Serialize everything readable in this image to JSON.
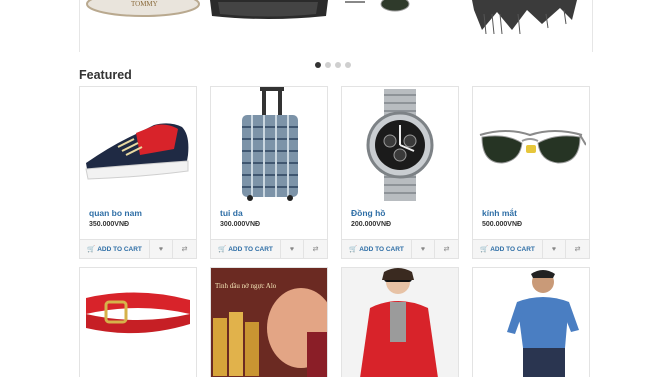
{
  "carousel": {
    "thumbs": [
      {
        "icon": "watch-thumb-icon",
        "text": "TOMMY"
      },
      {
        "icon": "cap-thumb-icon"
      },
      {
        "icon": "sunglasses-thumb-icon"
      },
      {
        "icon": "scarf-thumb-icon"
      }
    ],
    "dots": 4,
    "active_dot": 0
  },
  "featured": {
    "title": "Featured",
    "products": [
      {
        "name": "quan bo nam",
        "price": "350.000VNĐ",
        "icon": "sneaker-icon"
      },
      {
        "name": "tui da",
        "price": "300.000VNĐ",
        "icon": "luggage-icon"
      },
      {
        "name": "Đồng hồ",
        "price": "200.000VNĐ",
        "icon": "watch-icon"
      },
      {
        "name": "kính mắt",
        "price": "500.000VNĐ",
        "icon": "sunglasses-icon"
      }
    ],
    "add_to_cart_label": "ADD TO CART",
    "row2": [
      {
        "icon": "belt-icon"
      },
      {
        "icon": "cosmetics-ad-icon",
        "text": "Tinh dầu nở ngực Alo"
      },
      {
        "icon": "red-coat-model-icon"
      },
      {
        "icon": "polo-model-icon"
      }
    ]
  },
  "colors": {
    "link": "#2e6ea6",
    "accent_red": "#d8232a"
  }
}
